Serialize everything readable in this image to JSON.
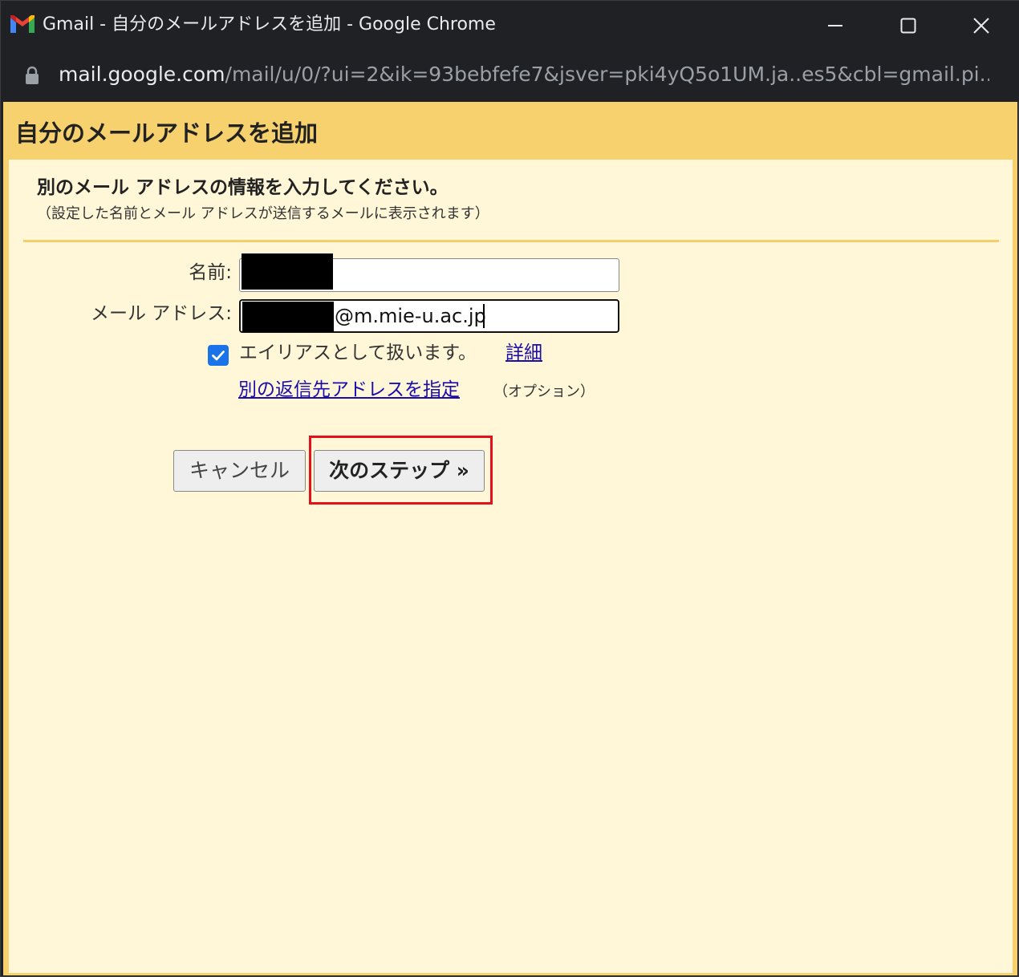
{
  "window": {
    "title": "Gmail - 自分のメールアドレスを追加 - Google Chrome",
    "url_host": "mail.google.com",
    "url_path": "/mail/u/0/?ui=2&ik=93bebfefe7&jsver=pki4yQ5o1UM.ja..es5&cbl=gmail.pi..."
  },
  "dialog": {
    "title": "自分のメールアドレスを追加",
    "heading": "別のメール アドレスの情報を入力してください。",
    "subheading": "（設定した名前とメール アドレスが送信するメールに表示されます）"
  },
  "form": {
    "name_label": "名前:",
    "email_label": "メール アドレス:",
    "email_value_domain": "@m.mie-u.ac.jp",
    "alias_checked": true,
    "alias_text": "エイリアスとして扱います。",
    "alias_link": "詳細",
    "reply_link": "別の返信先アドレスを指定",
    "reply_option": "（オプション）"
  },
  "buttons": {
    "cancel": "キャンセル",
    "next": "次のステップ »"
  },
  "colors": {
    "header_bg": "#f7d16e",
    "content_bg": "#fff7d8",
    "highlight": "#e3111b",
    "checkbox": "#1a73e8",
    "link": "#1a0dab"
  },
  "icons": {
    "app": "gmail-logo-icon",
    "lock": "lock-icon",
    "minimize": "minimize-icon",
    "maximize": "maximize-icon",
    "close": "close-icon",
    "check": "checkmark-icon"
  }
}
